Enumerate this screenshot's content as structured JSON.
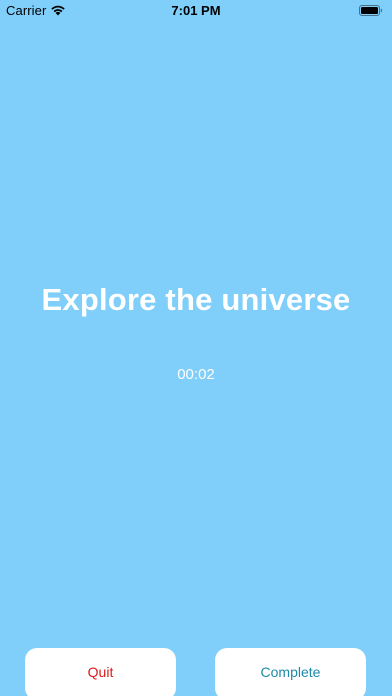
{
  "status_bar": {
    "carrier": "Carrier",
    "time": "7:01 PM",
    "wifi_icon": "wifi-icon",
    "battery_icon": "battery-icon"
  },
  "main": {
    "title": "Explore the universe",
    "timer": "00:02"
  },
  "buttons": {
    "quit_label": "Quit",
    "complete_label": "Complete"
  },
  "colors": {
    "background": "#80cffa",
    "title_text": "#ffffff",
    "quit_text": "#d81b1b",
    "complete_text": "#1e8aa8",
    "button_bg": "#ffffff"
  }
}
